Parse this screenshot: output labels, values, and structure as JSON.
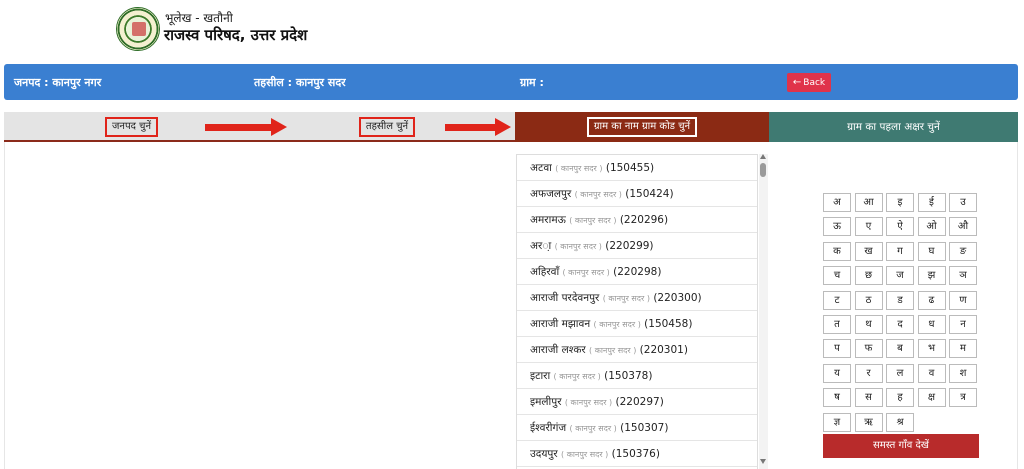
{
  "header": {
    "subtitle": "भूलेख - खतौनी",
    "title": "राजस्व परिषद, उत्तर प्रदेश"
  },
  "infobar": {
    "district": "जनपद : कानपुर नगर",
    "tehsil": "तहसील : कानपुर सदर",
    "village": "ग्राम :",
    "back_label": "Back",
    "back_icon": "←"
  },
  "tabs": {
    "district": "जनपद चुनें",
    "tehsil": "तहसील चुनें",
    "village": "ग्राम का नाम ग्राम कोड चुनें",
    "letter": "ग्राम का पहला अक्षर चुनें"
  },
  "villages": [
    {
      "name": "अटवा",
      "tehsil": "( कानपुर सदर )",
      "code": "(150455)"
    },
    {
      "name": "अफजलपुर",
      "tehsil": "( कानपुर सदर )",
      "code": "(150424)"
    },
    {
      "name": "अमरामऊ",
      "tehsil": "( कानपुर सदर )",
      "code": "(220296)"
    },
    {
      "name": "अर◌ा़",
      "tehsil": "( कानपुर सदर )",
      "code": "(220299)"
    },
    {
      "name": "अहिरवाँ",
      "tehsil": "( कानपुर सदर )",
      "code": "(220298)"
    },
    {
      "name": "आराजी परदेवनपुर",
      "tehsil": "( कानपुर सदर )",
      "code": "(220300)"
    },
    {
      "name": "आराजी मझावन",
      "tehsil": "( कानपुर सदर )",
      "code": "(150458)"
    },
    {
      "name": "आराजी लश्कर",
      "tehsil": "( कानपुर सदर )",
      "code": "(220301)"
    },
    {
      "name": "इटारा",
      "tehsil": "( कानपुर सदर )",
      "code": "(150378)"
    },
    {
      "name": "इमलीपुर",
      "tehsil": "( कानपुर सदर )",
      "code": "(220297)"
    },
    {
      "name": "ईश्वरीगंज",
      "tehsil": "( कानपुर सदर )",
      "code": "(150307)"
    },
    {
      "name": "उदयपुर",
      "tehsil": "( कानपुर सदर )",
      "code": "(150376)"
    }
  ],
  "letters": [
    [
      "अ",
      "आ",
      "इ",
      "ई",
      "उ"
    ],
    [
      "ऊ",
      "ए",
      "ऐ",
      "ओ",
      "औ"
    ],
    [
      "क",
      "ख",
      "ग",
      "घ",
      "ङ"
    ],
    [
      "च",
      "छ",
      "ज",
      "झ",
      "ञ"
    ],
    [
      "ट",
      "ठ",
      "ड",
      "ढ",
      "ण"
    ],
    [
      "त",
      "थ",
      "द",
      "ध",
      "न"
    ],
    [
      "प",
      "फ",
      "ब",
      "भ",
      "म"
    ],
    [
      "य",
      "र",
      "ल",
      "व",
      "श"
    ],
    [
      "ष",
      "स",
      "ह",
      "क्ष",
      "त्र"
    ],
    [
      "ज्ञ",
      "ऋ",
      "श्र"
    ]
  ],
  "show_all_label": "समस्त गाँव देखें",
  "colors": {
    "infobar": "#3a7fd1",
    "back_button": "#e0334a",
    "village_tab": "#8b2a14",
    "letter_tab": "#3f7a72",
    "show_all_button": "#b82b2b",
    "annotation_red": "#e0241a"
  }
}
